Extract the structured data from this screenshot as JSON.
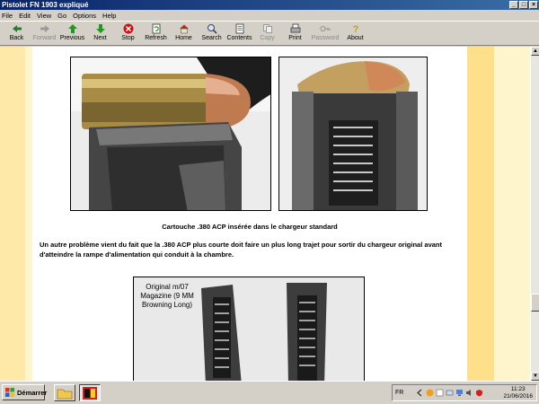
{
  "window": {
    "title": "Pistolet FN 1903 expliqué"
  },
  "menu": [
    "File",
    "Edit",
    "View",
    "Go",
    "Options",
    "Help"
  ],
  "toolbar": [
    {
      "label": "Back",
      "icon": "back-arrow-icon",
      "enabled": true
    },
    {
      "label": "Forward",
      "icon": "forward-arrow-icon",
      "enabled": false
    },
    {
      "label": "Previous",
      "icon": "previous-icon",
      "enabled": true
    },
    {
      "label": "Next",
      "icon": "next-icon",
      "enabled": true
    },
    {
      "label": "Stop",
      "icon": "stop-icon",
      "enabled": true
    },
    {
      "label": "Refresh",
      "icon": "refresh-icon",
      "enabled": true
    },
    {
      "label": "Home",
      "icon": "home-icon",
      "enabled": true
    },
    {
      "label": "Search",
      "icon": "search-icon",
      "enabled": true
    },
    {
      "label": "Contents",
      "icon": "contents-icon",
      "enabled": true
    },
    {
      "label": "Copy",
      "icon": "copy-icon",
      "enabled": false
    },
    {
      "label": "Print",
      "icon": "print-icon",
      "enabled": true
    },
    {
      "label": "Password",
      "icon": "password-icon",
      "enabled": false
    },
    {
      "label": "About",
      "icon": "about-icon",
      "enabled": true
    }
  ],
  "page": {
    "caption": "Cartouche .380 ACP insérée dans le chargeur standard",
    "paragraph": "Un autre problème vient du fait que la .380 ACP plus courte doit faire un plus long trajet pour sortir du chargeur original avant d'atteindre la rampe d'alimentation qui conduit à la chambre.",
    "photo3_label": "Original m/07 Magazine (9 MM Browning Long)"
  },
  "taskbar": {
    "start_label": "Démarrer",
    "language": "FR",
    "time": "11:23",
    "date": "21/06/2016"
  },
  "colors": {
    "titlebar": "#0a246a",
    "page_bg": "#ffdd88",
    "content_bg": "#ffffff"
  }
}
